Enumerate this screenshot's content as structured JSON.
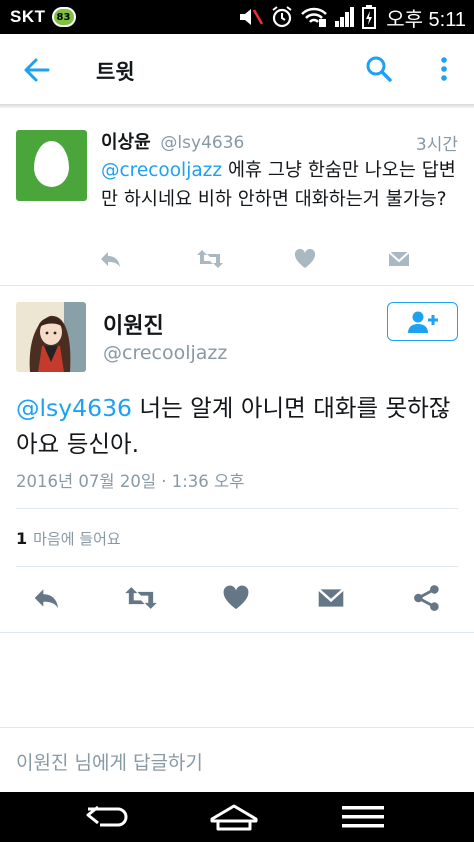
{
  "status_bar": {
    "carrier": "SKT",
    "carrier_badge": "83",
    "icons": [
      "mute-icon",
      "alarm-icon",
      "wifi-icon",
      "signal-icon",
      "battery-charging-icon"
    ],
    "time": "오후 5:11"
  },
  "app_bar": {
    "title": "트윗",
    "icons": [
      "back-arrow-icon",
      "search-icon",
      "more-vertical-icon"
    ]
  },
  "reply_tweet": {
    "name": "이상윤",
    "handle": "@lsy4636",
    "time": "3시간",
    "mention": "@crecooljazz",
    "text": " 에휴 그냥 한숨만 나오는 답변만 하시네요 비하 안하면 대화하는거 불가능?",
    "avatar": "default-egg-avatar",
    "actions": [
      "reply-icon",
      "retweet-icon",
      "like-icon",
      "direct-message-icon"
    ]
  },
  "main_tweet": {
    "name": "이원진",
    "handle": "@crecooljazz",
    "mention": "@lsy4636",
    "text": " 너는 알계 아니면 대화를 못하잖아요 등신아.",
    "date": "2016년 07월 20일 · 1:36 오후",
    "likes_count": "1",
    "likes_label": "마음에 들어요",
    "follow_icon": "follow-person-plus-icon",
    "actions": [
      "reply-icon",
      "retweet-icon",
      "like-icon",
      "direct-message-icon",
      "share-icon"
    ]
  },
  "composer": {
    "placeholder": "이원진 님에게 답글하기"
  },
  "nav_bar": {
    "icons": [
      "back-icon",
      "home-icon",
      "menu-icon"
    ]
  },
  "colors": {
    "accent": "#1da1f2",
    "secondary_text": "#8899a6",
    "egg_bg": "#4aa53a"
  }
}
